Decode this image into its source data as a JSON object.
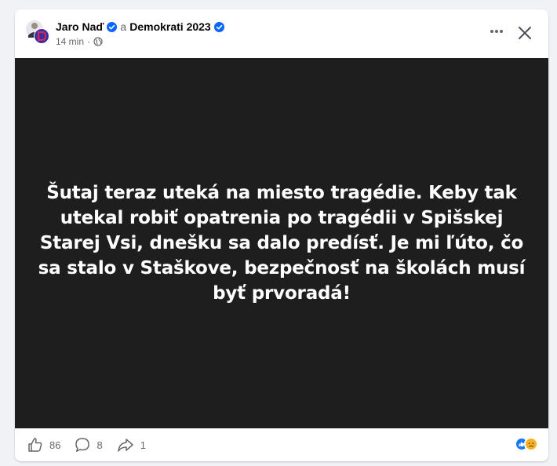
{
  "post": {
    "author": "Jaro Naď",
    "connector": "a",
    "page": "Demokrati 2023",
    "time": "14 min",
    "meta_separator": "·",
    "audience_icon": "globe-icon",
    "body_text": "Šutaj teraz uteká na miesto tragédie. Keby tak utekal robiť opatrenia po tragédii v Spišskej Starej Vsi, dnešku sa dalo predísť. Je mi ľúto, čo sa stalo v Staškove, bezpečnosť na školách musí byť prvoradá!"
  },
  "stats": {
    "likes": "86",
    "comments": "8",
    "shares": "1"
  },
  "reaction_icons": [
    "like-reaction-icon",
    "sad-reaction-icon"
  ],
  "colors": {
    "verified": "#0866ff",
    "like_reaction": "#1877f2",
    "sad_reaction": "#f7b125",
    "media_bg": "#1e1e1e",
    "card_bg": "#ffffff",
    "page_bg": "#f0f2f5",
    "secondary_text": "#65676b"
  }
}
